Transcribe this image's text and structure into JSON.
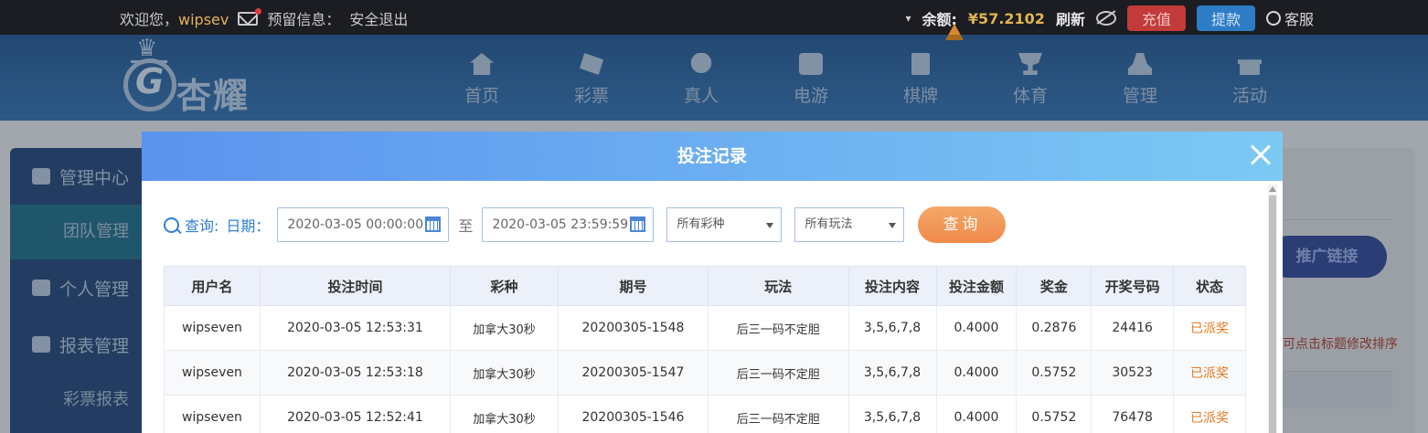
{
  "topbar": {
    "welcome": "欢迎您，",
    "username": "wipsev",
    "reserve_info": "预留信息：",
    "logout": "安全退出",
    "balance_label": "余额:",
    "balance_value": "¥57.2102",
    "refresh": "刷新",
    "deposit": "充值",
    "withdraw": "提款",
    "customer_service": "客服"
  },
  "navbar": {
    "brand": "杏耀",
    "items": [
      "首页",
      "彩票",
      "真人",
      "电游",
      "棋牌",
      "体育",
      "管理",
      "活动"
    ]
  },
  "sidebar": {
    "management_center": "管理中心",
    "team_management": "团队管理",
    "personal_management": "个人管理",
    "report_management": "报表管理",
    "lottery_report": "彩票报表"
  },
  "background": {
    "promo_link": "推广链接",
    "sort_hint": "可点击标题修改排序"
  },
  "modal": {
    "title": "投注记录",
    "query_label": "查询:",
    "date_label": "日期：",
    "start_date": "2020-03-05 00:00:00",
    "to": "至",
    "end_date": "2020-03-05 23:59:59",
    "lottery_select": "所有彩种",
    "play_select": "所有玩法",
    "query_button": "查询",
    "columns": [
      "用户名",
      "投注时间",
      "彩种",
      "期号",
      "玩法",
      "投注内容",
      "投注金额",
      "奖金",
      "开奖号码",
      "状态"
    ],
    "rows": [
      [
        "wipseven",
        "2020-03-05 12:53:31",
        "加拿大30秒",
        "20200305-1548",
        "后三一码不定胆",
        "3,5,6,7,8",
        "0.4000",
        "0.2876",
        "24416",
        "已派奖"
      ],
      [
        "wipseven",
        "2020-03-05 12:53:18",
        "加拿大30秒",
        "20200305-1547",
        "后三一码不定胆",
        "3,5,6,7,8",
        "0.4000",
        "0.5752",
        "30523",
        "已派奖"
      ],
      [
        "wipseven",
        "2020-03-05 12:52:41",
        "加拿大30秒",
        "20200305-1546",
        "后三一码不定胆",
        "3,5,6,7,8",
        "0.4000",
        "0.5752",
        "76478",
        "已派奖"
      ]
    ]
  }
}
